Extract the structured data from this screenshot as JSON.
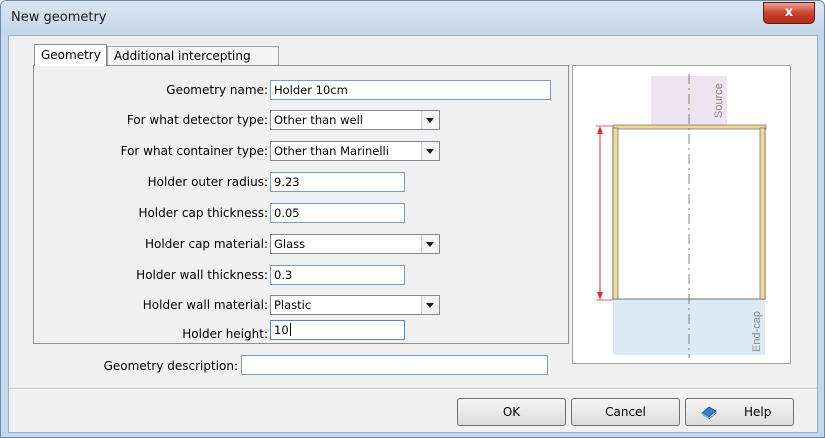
{
  "window": {
    "title": "New geometry",
    "close_label": "x"
  },
  "tabs": [
    {
      "label": "Geometry",
      "active": true
    },
    {
      "label": "Additional intercepting layers",
      "active": false
    }
  ],
  "form": {
    "geometry_name": {
      "label": "Geometry name:",
      "value": "Holder 10cm"
    },
    "detector_type": {
      "label": "For what detector type:",
      "value": "Other than well"
    },
    "container_type": {
      "label": "For what container type:",
      "value": "Other than Marinelli"
    },
    "outer_radius": {
      "label": "Holder outer radius:",
      "value": "9.23"
    },
    "cap_thickness": {
      "label": "Holder cap thickness:",
      "value": "0.05"
    },
    "cap_material": {
      "label": "Holder cap material:",
      "value": "Glass"
    },
    "wall_thickness": {
      "label": "Holder wall thickness:",
      "value": "0.3"
    },
    "wall_material": {
      "label": "Holder wall material:",
      "value": "Plastic"
    },
    "height": {
      "label": "Holder height:",
      "value": "10"
    }
  },
  "description": {
    "label": "Geometry description:",
    "value": ""
  },
  "preview": {
    "source_label": "Source",
    "endcap_label": "End-cap",
    "colors": {
      "source_fill": "#efe3ef",
      "endcap_fill": "#dde9f3",
      "holder_wall": "#f2d79c",
      "dimension_arrow": "#d9342b",
      "axis": "#666666"
    }
  },
  "buttons": {
    "ok": "OK",
    "cancel": "Cancel",
    "help": "Help"
  }
}
